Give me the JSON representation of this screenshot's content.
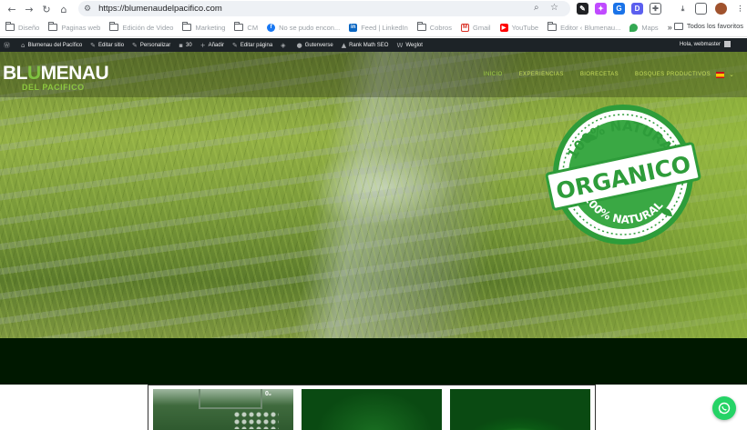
{
  "browser": {
    "url": "https://blumenaudelpacifico.com",
    "extensions": [
      {
        "letter": "",
        "color": "#202124"
      },
      {
        "letter": "",
        "color": "#c04aff"
      },
      {
        "letter": "",
        "color": "#1a73e8"
      },
      {
        "letter": "D",
        "color": "#5b5fef"
      }
    ]
  },
  "bookmarks": {
    "items": [
      {
        "label": "Diseño",
        "icon": "folder-icon"
      },
      {
        "label": "Paginas web",
        "icon": "folder-icon"
      },
      {
        "label": "Edición de Video",
        "icon": "folder-icon"
      },
      {
        "label": "Marketing",
        "icon": "folder-icon"
      },
      {
        "label": "CM",
        "icon": "folder-icon"
      },
      {
        "label": "No se pudo encon...",
        "icon": "facebook-icon"
      },
      {
        "label": "Feed | LinkedIn",
        "icon": "linkedin-icon"
      },
      {
        "label": "Cobros",
        "icon": "folder-icon"
      },
      {
        "label": "Gmail",
        "icon": "gmail-icon"
      },
      {
        "label": "YouTube",
        "icon": "youtube-icon"
      },
      {
        "label": "Editor ‹ Blumenau...",
        "icon": "folder-icon"
      },
      {
        "label": "Maps",
        "icon": "maps-icon"
      }
    ],
    "more": "»",
    "all_label": "Todos los favoritos"
  },
  "adminbar": {
    "items": [
      {
        "label": "",
        "icon": "wordpress-icon"
      },
      {
        "label": "Blumenau del Pacífico",
        "icon": "home-icon"
      },
      {
        "label": "Editar sitio",
        "icon": "pencil-icon"
      },
      {
        "label": "Personalizar",
        "icon": "brush-icon"
      },
      {
        "label": "30",
        "icon": "comment-icon"
      },
      {
        "label": "Añadir",
        "icon": "plus-icon"
      },
      {
        "label": "Editar página",
        "icon": "pencil-icon"
      },
      {
        "label": "",
        "icon": "diamond-icon"
      },
      {
        "label": "Gutenverse",
        "icon": "gutenverse-icon"
      },
      {
        "label": "Rank Math SEO",
        "icon": "rankmath-icon"
      },
      {
        "label": "Weglot",
        "icon": "weglot-icon"
      }
    ],
    "greeting": "Hola, webmaster"
  },
  "site": {
    "logo_main_a": "BL",
    "logo_main_b": "U",
    "logo_main_c": "MENAU",
    "logo_sub": "DEL PACIFICO",
    "menu": [
      "INICIO",
      "EXPERIENCIAS",
      "BIORECETAS",
      "BOSQUES PRODUCTIVOS"
    ],
    "seal": {
      "top_text": "100% NATURAL",
      "center_text": "ORGANICO",
      "bottom_text": "100% NATURAL"
    },
    "card1_tag": "0₂"
  },
  "colors": {
    "brand_green": "#8cc63f",
    "dark_band": "#001800",
    "whatsapp": "#25d366"
  }
}
